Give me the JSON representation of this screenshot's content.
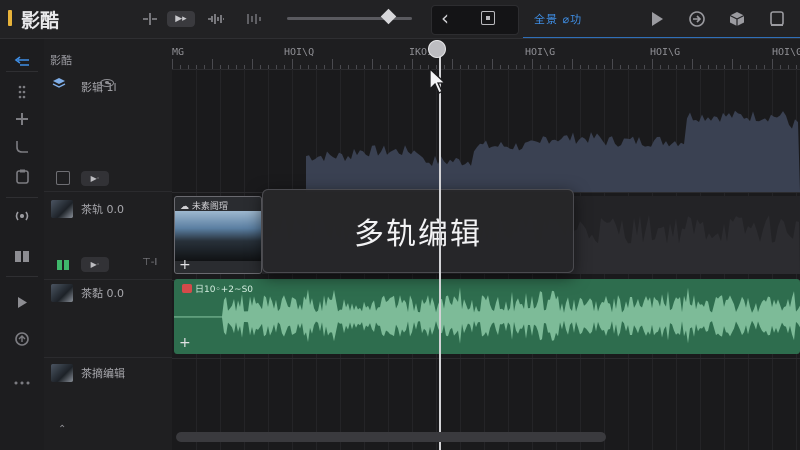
{
  "app": {
    "title": "影酷",
    "accent_color": "#e8b33a"
  },
  "toolbar": {
    "tabs_label": "全景 ⌀功",
    "back_icon": "chevron-left-icon",
    "frame_icon": "frame-icon",
    "playback_icons": [
      "split-icon",
      "play-icon",
      "waveform-icon",
      "trim-icon"
    ],
    "right_icons": [
      "play-icon",
      "export-icon",
      "box-icon",
      "window-icon"
    ]
  },
  "sidebar": {
    "rail_icons": [
      "back-arrow-icon",
      "grip-icon",
      "plus-icon",
      "curve-icon",
      "clipboard-icon",
      "broadcast-icon",
      "book-icon",
      "play-icon",
      "sync-icon",
      "more-icon"
    ]
  },
  "headers": {
    "column_title": "影酷",
    "tracks": [
      {
        "name": "影辑 1l",
        "badge": "▶·"
      },
      {
        "name": "茶轨 0.0",
        "badge": "▶·",
        "extra": "⊤-I"
      },
      {
        "name": "茶黏 0.0"
      },
      {
        "name": "茶摘编辑"
      }
    ],
    "bottom_handle": "⌃"
  },
  "timeline": {
    "ruler_labels": [
      "MG",
      "HOI\\Q",
      "IKOI",
      "HOI\\G",
      "HOI\\G",
      "HOI\\G"
    ],
    "video_clip_title": "未素阁瑁",
    "audio_clip_title": "日10◦+2~S0",
    "plus_symbol": "+",
    "overlay_title": "多轨编辑",
    "audio_color": "#2e6d4e",
    "accent_blue": "#3f8fe6"
  }
}
